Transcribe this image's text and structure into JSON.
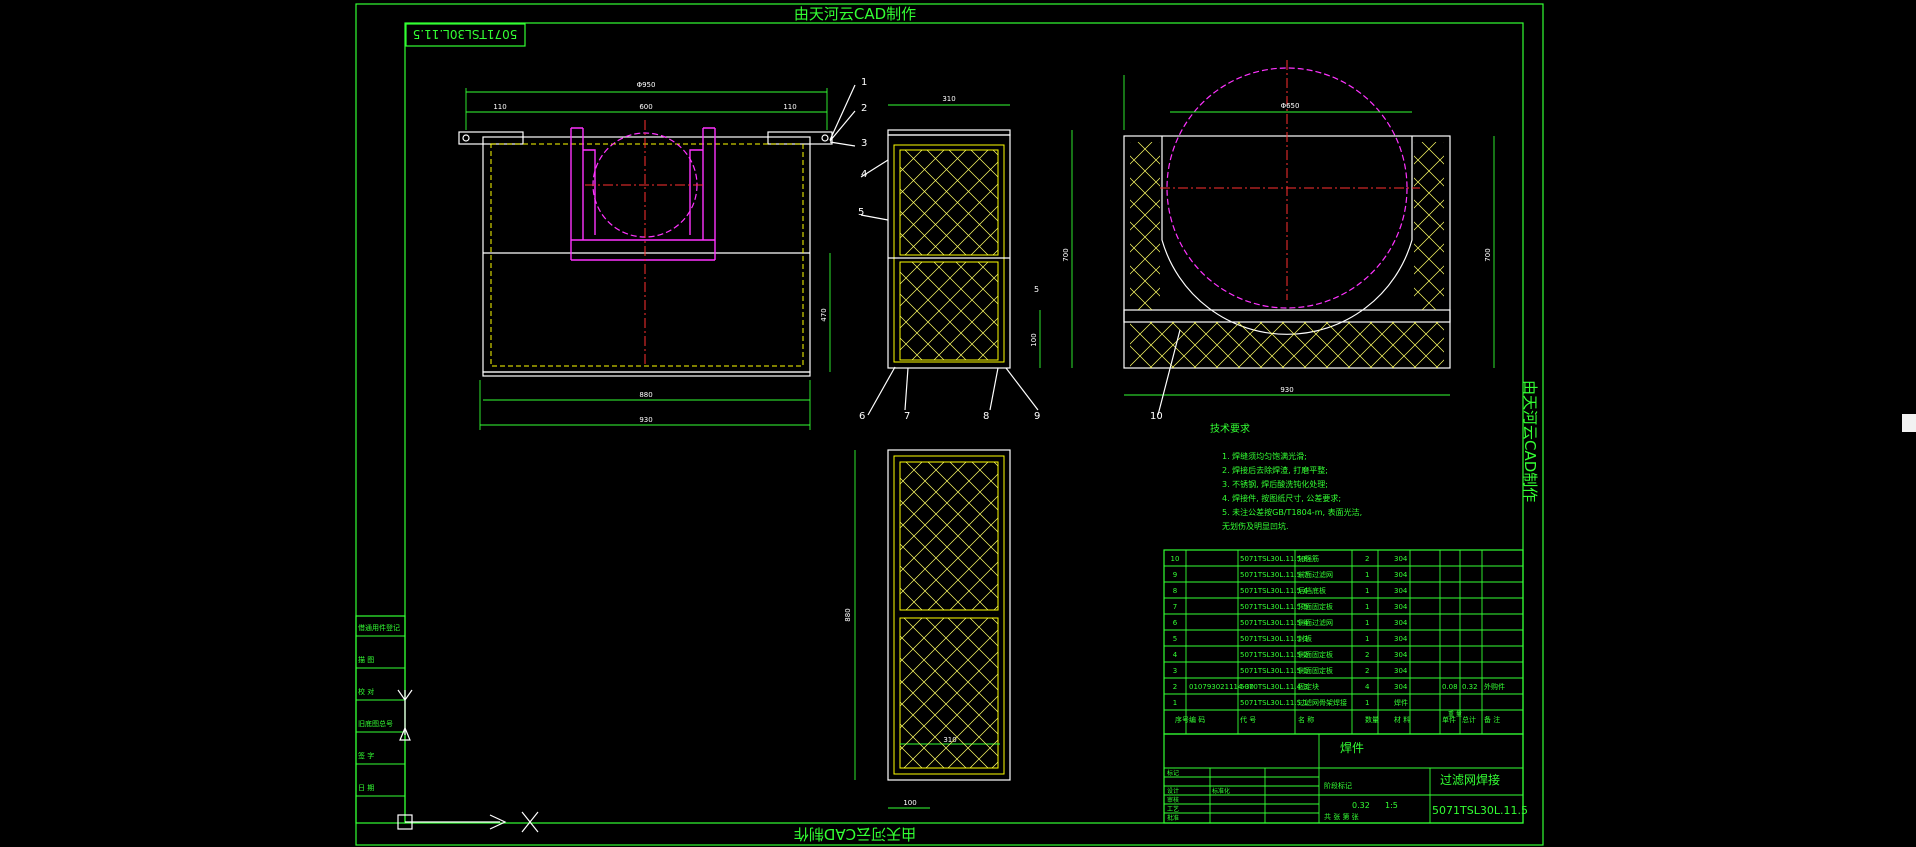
{
  "drawing": {
    "watermark_top": "由天河云CAD制作",
    "watermark_bottom": "由天河云CAD制作",
    "watermark_side": "由天河云CAD制作",
    "drawing_code_box": "5071TSL30L.11.5"
  },
  "dims": {
    "top_overall": "Φ950",
    "top_left": "110",
    "top_mid": "600",
    "top_right": "110",
    "bottom_inner": "880",
    "bottom_outer": "930",
    "left_height": "470",
    "side_width": "310",
    "side_height": "700",
    "side_small": "100",
    "side_edge": "5",
    "right_width": "930",
    "right_height": "700",
    "circle_dia": "Φ650",
    "right_base": "930",
    "lower_width": "310",
    "lower_height": "880",
    "lower_bottom": "100"
  },
  "balloons": [
    "1",
    "2",
    "3",
    "4",
    "5",
    "6",
    "7",
    "8",
    "9",
    "10"
  ],
  "tech_req": {
    "title": "技术要求",
    "items": [
      "1. 焊缝须均匀饱满光滑;",
      "2. 焊接后去除焊渣, 打磨平整;",
      "3. 不锈钢, 焊后酸洗钝化处理;",
      "4. 焊接件, 按图纸尺寸, 公差要求;",
      "5. 未注公差按GB/T1804-m, 表面光洁,",
      "   无划伤及明显凹坑."
    ]
  },
  "bom": {
    "rows": [
      {
        "no": "10",
        "code": "",
        "part": "5071TSL30L.11.5-8",
        "name": "加强筋",
        "qty": "2",
        "mat": "304",
        "w1": "",
        "w2": "",
        "note": ""
      },
      {
        "no": "9",
        "code": "",
        "part": "5071TSL30L.11.5-7",
        "name": "前面过滤网",
        "qty": "1",
        "mat": "304",
        "w1": "",
        "w2": "",
        "note": ""
      },
      {
        "no": "8",
        "code": "",
        "part": "5071TSL30L.11.5-6",
        "name": "后挡底板",
        "qty": "1",
        "mat": "304",
        "w1": "",
        "w2": "",
        "note": ""
      },
      {
        "no": "7",
        "code": "",
        "part": "5071TSL30L.11.5-5",
        "name": "顶面固定板",
        "qty": "1",
        "mat": "304",
        "w1": "",
        "w2": "",
        "note": ""
      },
      {
        "no": "6",
        "code": "",
        "part": "5071TSL30L.11.5-4",
        "name": "侧面过滤网",
        "qty": "1",
        "mat": "304",
        "w1": "",
        "w2": "",
        "note": ""
      },
      {
        "no": "5",
        "code": "",
        "part": "5071TSL30L.11.5-3",
        "name": "封板",
        "qty": "1",
        "mat": "304",
        "w1": "",
        "w2": "",
        "note": ""
      },
      {
        "no": "4",
        "code": "",
        "part": "5071TSL30L.11.5-2",
        "name": "侧面固定板",
        "qty": "2",
        "mat": "304",
        "w1": "",
        "w2": "",
        "note": ""
      },
      {
        "no": "3",
        "code": "",
        "part": "5071TSL30L.11.5-1",
        "name": "侧面固定板",
        "qty": "2",
        "mat": "304",
        "w1": "",
        "w2": "",
        "note": ""
      },
      {
        "no": "2",
        "code": "010793021114-30",
        "part": "5070TSL30L.11.4-3",
        "name": "固定块",
        "qty": "4",
        "mat": "304",
        "w1": "0.08",
        "w2": "0.32",
        "note": "外购件"
      },
      {
        "no": "1",
        "code": "",
        "part": "5071TSL30L.11.5.1",
        "name": "过滤网骨架焊接",
        "qty": "1",
        "mat": "焊件",
        "w1": "",
        "w2": "",
        "note": ""
      }
    ],
    "headers": [
      "序号",
      "编 码",
      "代 号",
      "名 称",
      "数量",
      "材 料",
      "单件",
      "总计",
      "备 注"
    ],
    "weight_header": "重 量"
  },
  "title_block": {
    "material": "焊件",
    "drawing_name": "过滤网焊接",
    "drawing_no": "5071TSL30L.11.5",
    "weight": "0.32",
    "scale": "1:5",
    "labels_left": [
      "标记",
      "处数",
      "更改文件号",
      "签字",
      "日期"
    ],
    "labels_left2": [
      "设计",
      "审核",
      "工艺",
      "批准"
    ],
    "mid_labels": [
      "标准化",
      "阶段标记",
      "重量",
      "比例"
    ],
    "sheet_label": "共  张    第  张"
  },
  "left_strip": {
    "items": [
      "借通用件登记",
      "旧底图总号",
      "签 字",
      "日 期",
      "描 图",
      "校 对",
      "审 核"
    ]
  }
}
